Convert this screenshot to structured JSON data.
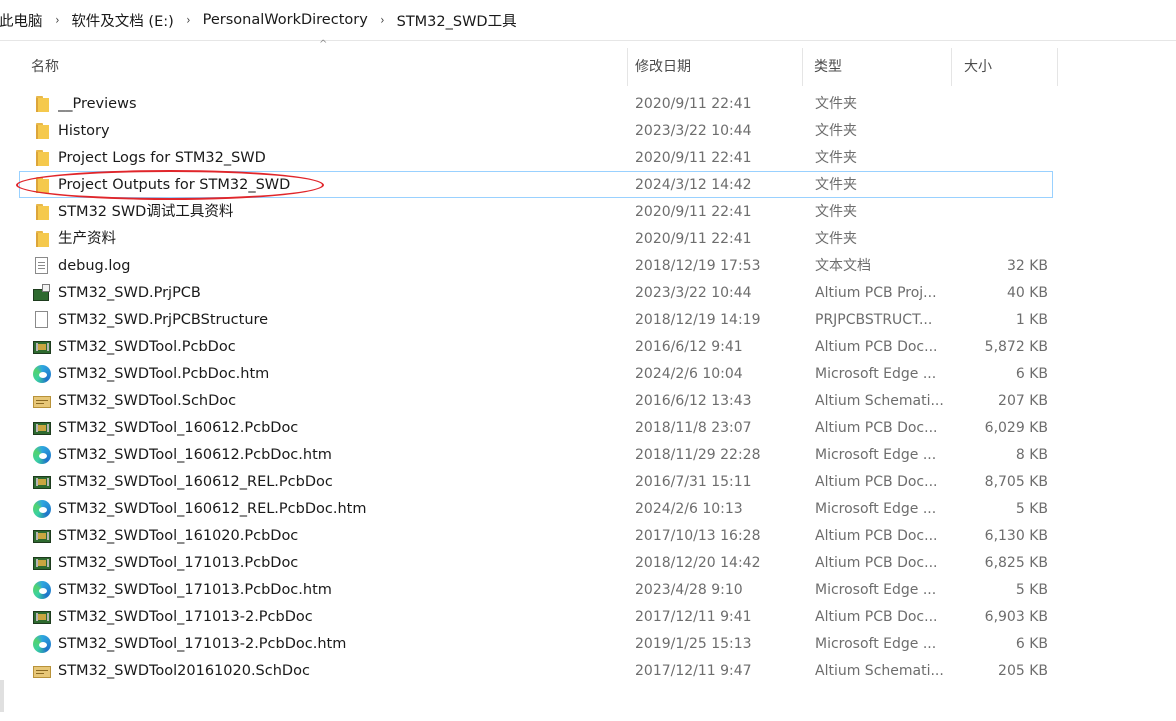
{
  "breadcrumb": {
    "items": [
      "此电脑",
      "软件及文档 (E:)",
      "PersonalWorkDirectory",
      "STM32_SWD工具"
    ],
    "separator": "›"
  },
  "columns": {
    "name": "名称",
    "date": "修改日期",
    "type": "类型",
    "size": "大小",
    "sort_indicator": "^"
  },
  "files": [
    {
      "name": "__Previews",
      "date": "2020/9/11 22:41",
      "type": "文件夹",
      "size": "",
      "icon": "folder-icon"
    },
    {
      "name": "History",
      "date": "2023/3/22 10:44",
      "type": "文件夹",
      "size": "",
      "icon": "folder-icon"
    },
    {
      "name": "Project Logs for STM32_SWD",
      "date": "2020/9/11 22:41",
      "type": "文件夹",
      "size": "",
      "icon": "folder-icon"
    },
    {
      "name": "Project Outputs for STM32_SWD",
      "date": "2024/3/12 14:42",
      "type": "文件夹",
      "size": "",
      "icon": "folder-icon",
      "selected": true
    },
    {
      "name": "STM32 SWD调试工具资料",
      "date": "2020/9/11 22:41",
      "type": "文件夹",
      "size": "",
      "icon": "folder-icon"
    },
    {
      "name": "生产资料",
      "date": "2020/9/11 22:41",
      "type": "文件夹",
      "size": "",
      "icon": "folder-icon"
    },
    {
      "name": "debug.log",
      "date": "2018/12/19 17:53",
      "type": "文本文档",
      "size": "32 KB",
      "icon": "text-document-icon"
    },
    {
      "name": "STM32_SWD.PrjPCB",
      "date": "2023/3/22 10:44",
      "type": "Altium PCB Proj...",
      "size": "40 KB",
      "icon": "altium-project-icon"
    },
    {
      "name": "STM32_SWD.PrjPCBStructure",
      "date": "2018/12/19 14:19",
      "type": "PRJPCBSTRUCT...",
      "size": "1 KB",
      "icon": "blank-file-icon"
    },
    {
      "name": "STM32_SWDTool.PcbDoc",
      "date": "2016/6/12 9:41",
      "type": "Altium PCB Doc...",
      "size": "5,872 KB",
      "icon": "pcb-document-icon"
    },
    {
      "name": "STM32_SWDTool.PcbDoc.htm",
      "date": "2024/2/6 10:04",
      "type": "Microsoft Edge ...",
      "size": "6 KB",
      "icon": "edge-html-icon"
    },
    {
      "name": "STM32_SWDTool.SchDoc",
      "date": "2016/6/12 13:43",
      "type": "Altium Schemati...",
      "size": "207 KB",
      "icon": "schematic-document-icon"
    },
    {
      "name": "STM32_SWDTool_160612.PcbDoc",
      "date": "2018/11/8 23:07",
      "type": "Altium PCB Doc...",
      "size": "6,029 KB",
      "icon": "pcb-document-icon"
    },
    {
      "name": "STM32_SWDTool_160612.PcbDoc.htm",
      "date": "2018/11/29 22:28",
      "type": "Microsoft Edge ...",
      "size": "8 KB",
      "icon": "edge-html-icon"
    },
    {
      "name": "STM32_SWDTool_160612_REL.PcbDoc",
      "date": "2016/7/31 15:11",
      "type": "Altium PCB Doc...",
      "size": "8,705 KB",
      "icon": "pcb-document-icon"
    },
    {
      "name": "STM32_SWDTool_160612_REL.PcbDoc.htm",
      "date": "2024/2/6 10:13",
      "type": "Microsoft Edge ...",
      "size": "5 KB",
      "icon": "edge-html-icon"
    },
    {
      "name": "STM32_SWDTool_161020.PcbDoc",
      "date": "2017/10/13 16:28",
      "type": "Altium PCB Doc...",
      "size": "6,130 KB",
      "icon": "pcb-document-icon"
    },
    {
      "name": "STM32_SWDTool_171013.PcbDoc",
      "date": "2018/12/20 14:42",
      "type": "Altium PCB Doc...",
      "size": "6,825 KB",
      "icon": "pcb-document-icon"
    },
    {
      "name": "STM32_SWDTool_171013.PcbDoc.htm",
      "date": "2023/4/28 9:10",
      "type": "Microsoft Edge ...",
      "size": "5 KB",
      "icon": "edge-html-icon"
    },
    {
      "name": "STM32_SWDTool_171013-2.PcbDoc",
      "date": "2017/12/11 9:41",
      "type": "Altium PCB Doc...",
      "size": "6,903 KB",
      "icon": "pcb-document-icon"
    },
    {
      "name": "STM32_SWDTool_171013-2.PcbDoc.htm",
      "date": "2019/1/25 15:13",
      "type": "Microsoft Edge ...",
      "size": "6 KB",
      "icon": "edge-html-icon"
    },
    {
      "name": "STM32_SWDTool20161020.SchDoc",
      "date": "2017/12/11 9:47",
      "type": "Altium Schemati...",
      "size": "205 KB",
      "icon": "schematic-document-icon"
    }
  ],
  "colors": {
    "selection_border": "#99d1ff",
    "annotation": "#e0262b",
    "folder": "#f5c94d"
  }
}
